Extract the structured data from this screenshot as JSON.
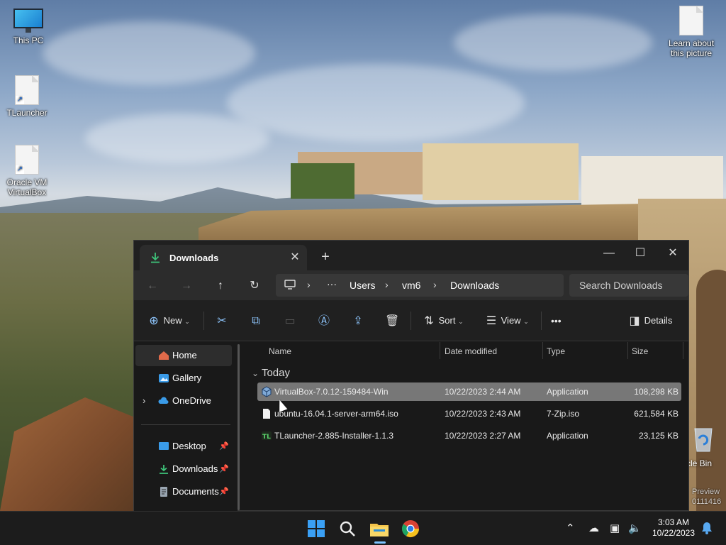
{
  "desktop": {
    "icons": [
      {
        "label": "This PC",
        "icon": "monitor-icon"
      },
      {
        "label": "TLauncher",
        "icon": "document-shortcut-icon"
      },
      {
        "label": "Oracle VM VirtualBox",
        "icon": "document-shortcut-icon"
      },
      {
        "label": "Learn about this picture",
        "icon": "document-icon"
      }
    ],
    "recycle_bin_label": "cle Bin",
    "watermark": [
      "Preview",
      "0111416"
    ]
  },
  "window": {
    "tab_title": "Downloads",
    "tab_close": "✕",
    "new_tab": "+",
    "controls": {
      "minimize": "—",
      "maximize": "☐",
      "close": "✕"
    }
  },
  "address": {
    "more": "···",
    "crumbs": [
      "Users",
      "vm6",
      "Downloads"
    ],
    "search_placeholder": "Search Downloads"
  },
  "toolbar": {
    "new_label": "New",
    "sort_label": "Sort",
    "view_label": "View",
    "more": "•••",
    "details_label": "Details"
  },
  "sidebar": {
    "items": [
      {
        "label": "Home",
        "icon": "home-icon",
        "color": "#e06a4a"
      },
      {
        "label": "Gallery",
        "icon": "gallery-icon",
        "color": "#3a9be8"
      },
      {
        "label": "OneDrive",
        "icon": "cloud-icon",
        "color": "#3a9be8"
      },
      {
        "label": "Desktop",
        "icon": "desktop-icon",
        "color": "#3a9be8"
      },
      {
        "label": "Downloads",
        "icon": "download-icon",
        "color": "#3ec47a"
      },
      {
        "label": "Documents",
        "icon": "documents-icon",
        "color": "#9aa6b2"
      }
    ]
  },
  "content": {
    "columns": [
      "Name",
      "Date modified",
      "Type",
      "Size"
    ],
    "group": "Today",
    "files": [
      {
        "name": "VirtualBox-7.0.12-159484-Win",
        "date": "10/22/2023 2:44 AM",
        "type": "Application",
        "size": "108,298 KB",
        "icon": "virtualbox-icon"
      },
      {
        "name": "ubuntu-16.04.1-server-arm64.iso",
        "date": "10/22/2023 2:43 AM",
        "type": "7-Zip.iso",
        "size": "621,584 KB",
        "icon": "file-icon"
      },
      {
        "name": "TLauncher-2.885-Installer-1.1.3",
        "date": "10/22/2023 2:27 AM",
        "type": "Application",
        "size": "23,125 KB",
        "icon": "tlauncher-icon"
      }
    ]
  },
  "taskbar": {
    "time": "3:03 AM",
    "date": "10/22/2023"
  },
  "colors": {
    "accent": "#7cc3ff",
    "selection": "#777777",
    "window_bg": "#191919"
  }
}
